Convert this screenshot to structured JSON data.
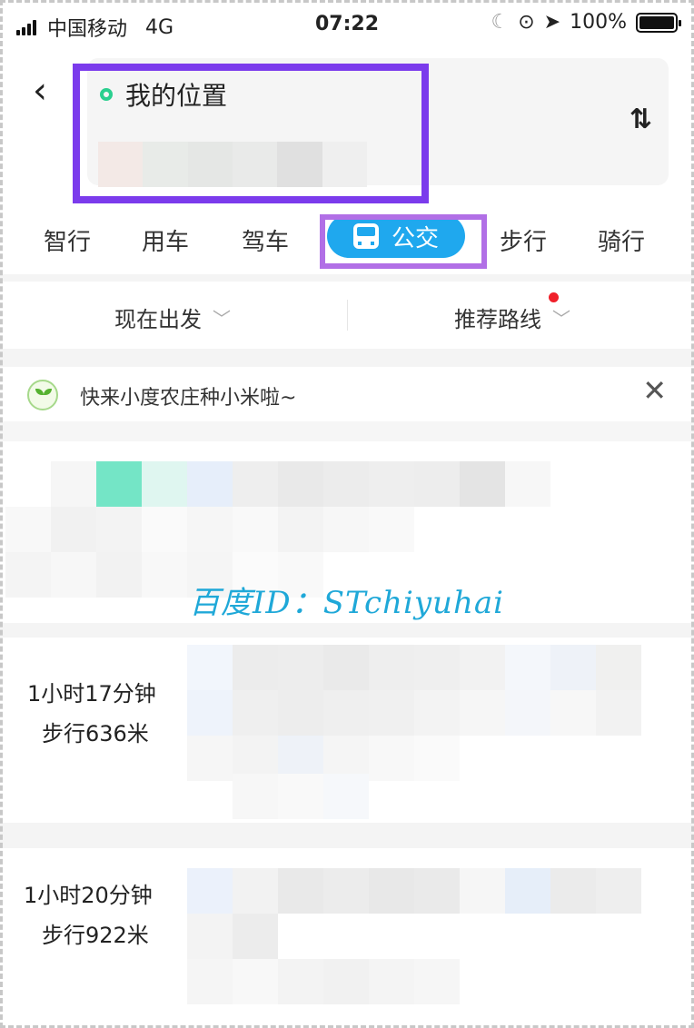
{
  "status_bar": {
    "carrier": "中国移动",
    "network": "4G",
    "time": "07:22",
    "battery": "100%",
    "battery_level": 1.0
  },
  "header": {
    "back_label": "‹",
    "origin_label": "我的位置",
    "swap_label": "⇅"
  },
  "mode_tabs": [
    {
      "label": "智行"
    },
    {
      "label": "用车"
    },
    {
      "label": "驾车"
    },
    {
      "label": "公交",
      "active": true
    },
    {
      "label": "步行"
    },
    {
      "label": "骑行"
    }
  ],
  "options": {
    "depart": "现在出发",
    "route_pref": "推荐路线"
  },
  "banner": {
    "text": "快来小度农庄种小米啦~",
    "close_label": "✕"
  },
  "watermark": "百度ID：STchiyuhai",
  "routes": [
    {
      "duration": "1小时17分钟",
      "walk": "步行636米"
    },
    {
      "duration": "1小时20分钟",
      "walk": "步行922米"
    }
  ],
  "colors": {
    "accent": "#1fa8ee",
    "highlight_box": "#7b3bec",
    "tab_highlight": "#b16fe6",
    "origin_dot": "#2bcf8f",
    "notification_dot": "#f0202a",
    "watermark": "#1fa8d8"
  }
}
